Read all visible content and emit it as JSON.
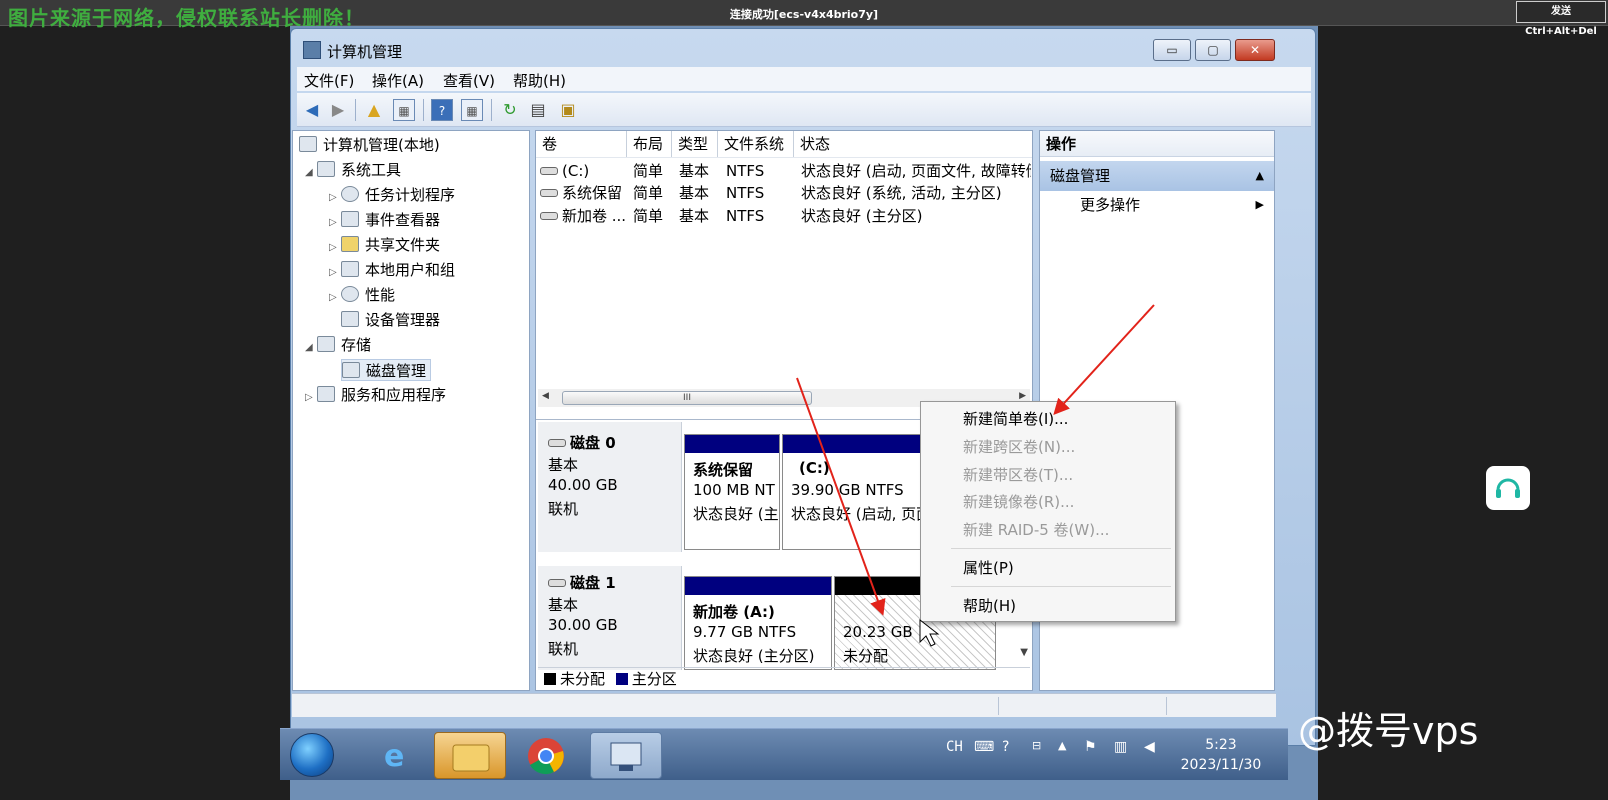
{
  "remote": {
    "watermark": "图片来源于网络，侵权联系站长删除！",
    "connection_status": "连接成功[ecs-v4x4brio7y]",
    "send_keys_label": "发送 Ctrl+Alt+Del"
  },
  "window": {
    "title": "计算机管理",
    "minimize": "▭",
    "maximize": "▢",
    "close": "✕"
  },
  "menu": [
    "文件(F)",
    "操作(A)",
    "查看(V)",
    "帮助(H)"
  ],
  "tree": {
    "root": "计算机管理(本地)",
    "system_tools": "系统工具",
    "task_scheduler": "任务计划程序",
    "event_viewer": "事件查看器",
    "shared_folders": "共享文件夹",
    "local_users": "本地用户和组",
    "performance": "性能",
    "device_manager": "设备管理器",
    "storage": "存储",
    "disk_management": "磁盘管理",
    "services_apps": "服务和应用程序"
  },
  "volume_list": {
    "columns": [
      "卷",
      "布局",
      "类型",
      "文件系统",
      "状态"
    ],
    "rows": [
      [
        "(C:)",
        "简单",
        "基本",
        "NTFS",
        "状态良好 (启动, 页面文件, 故障转储"
      ],
      [
        "系统保留",
        "简单",
        "基本",
        "NTFS",
        "状态良好 (系统, 活动, 主分区)"
      ],
      [
        "新加卷 ...",
        "简单",
        "基本",
        "NTFS",
        "状态良好 (主分区)"
      ]
    ],
    "scroll_thumb": "III"
  },
  "disks": [
    {
      "name": "磁盘 0",
      "type": "基本",
      "size": "40.00 GB",
      "status": "联机",
      "partitions": [
        {
          "name": "系统保留",
          "size": "100 MB NT",
          "status": "状态良好 (主"
        },
        {
          "name": "(C:)",
          "size": "39.90 GB NTFS",
          "status": "状态良好 (启动, 页面"
        }
      ]
    },
    {
      "name": "磁盘 1",
      "type": "基本",
      "size": "30.00 GB",
      "status": "联机",
      "partitions": [
        {
          "name": "新加卷  (A:)",
          "size": "9.77 GB NTFS",
          "status": "状态良好 (主分区)"
        },
        {
          "name": "",
          "size": "20.23 GB",
          "status": "未分配"
        }
      ]
    }
  ],
  "legend": {
    "unallocated": "未分配",
    "primary": "主分区"
  },
  "colors": {
    "unallocated": "#000000",
    "primary": "#00007f",
    "annotation_arrow": "#e2231a"
  },
  "actions": {
    "header": "操作",
    "section": "磁盘管理",
    "more": "更多操作"
  },
  "context_menu": {
    "new_simple": "新建简单卷(I)...",
    "new_spanned": "新建跨区卷(N)...",
    "new_striped": "新建带区卷(T)...",
    "new_mirrored": "新建镜像卷(R)...",
    "new_raid5": "新建 RAID-5 卷(W)...",
    "properties": "属性(P)",
    "help": "帮助(H)"
  },
  "taskbar": {
    "lang": "CH",
    "time": "5:23",
    "date": "2023/11/30"
  },
  "brand": "@拨号vps",
  "icons": [
    "back-arrow-icon",
    "forward-arrow-icon",
    "folder-up-icon",
    "console-tree-icon",
    "help-icon",
    "refresh-icon",
    "export-icon",
    "properties-icon"
  ]
}
